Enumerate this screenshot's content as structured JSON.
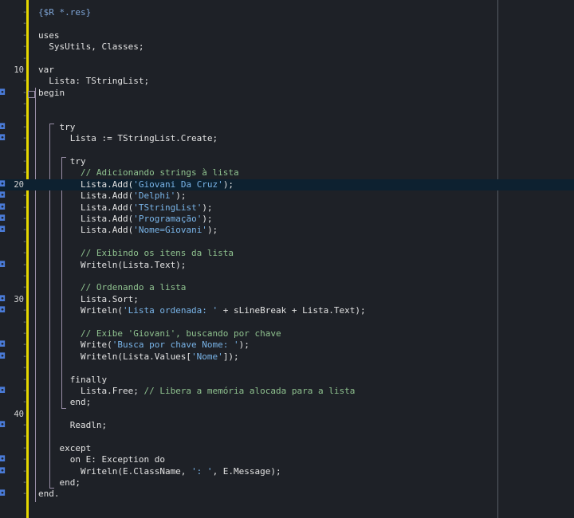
{
  "editor": {
    "lines": [
      {
        "ln": "",
        "marker": "",
        "segments": [
          {
            "t": "d",
            "v": "{$R *.res}"
          }
        ]
      },
      {
        "ln": "",
        "marker": "",
        "segments": []
      },
      {
        "ln": "",
        "marker": "",
        "segments": [
          {
            "t": "k",
            "v": "uses"
          }
        ]
      },
      {
        "ln": "",
        "marker": "",
        "segments": [
          {
            "t": "k",
            "v": "  SysUtils, Classes;"
          }
        ]
      },
      {
        "ln": "",
        "marker": "",
        "segments": []
      },
      {
        "ln": "10",
        "marker": "",
        "segments": [
          {
            "t": "k",
            "v": "var"
          }
        ]
      },
      {
        "ln": "",
        "marker": "",
        "segments": [
          {
            "t": "k",
            "v": "  Lista: TStringList;"
          }
        ]
      },
      {
        "ln": "",
        "marker": "bp",
        "segments": [
          {
            "t": "k",
            "v": "begin"
          }
        ]
      },
      {
        "ln": "",
        "marker": "",
        "segments": []
      },
      {
        "ln": "",
        "marker": "",
        "segments": []
      },
      {
        "ln": "",
        "marker": "bp",
        "segments": [
          {
            "t": "k",
            "v": "    try"
          }
        ]
      },
      {
        "ln": "",
        "marker": "bp",
        "segments": [
          {
            "t": "k",
            "v": "      Lista := TStringList.Create;"
          }
        ]
      },
      {
        "ln": "",
        "marker": "",
        "segments": []
      },
      {
        "ln": "",
        "marker": "",
        "segments": [
          {
            "t": "k",
            "v": "      try"
          }
        ]
      },
      {
        "ln": "",
        "marker": "",
        "segments": [
          {
            "t": "c",
            "v": "        // Adicionando strings à lista"
          }
        ]
      },
      {
        "ln": "20",
        "marker": "bp",
        "current": true,
        "segments": [
          {
            "t": "k",
            "v": "        Lista.Add("
          },
          {
            "t": "s",
            "v": "'Giovani Da Cruz'"
          },
          {
            "t": "k",
            "v": ");"
          }
        ]
      },
      {
        "ln": "",
        "marker": "bp",
        "segments": [
          {
            "t": "k",
            "v": "        Lista.Add("
          },
          {
            "t": "s",
            "v": "'Delphi'"
          },
          {
            "t": "k",
            "v": ");"
          }
        ]
      },
      {
        "ln": "",
        "marker": "bp",
        "segments": [
          {
            "t": "k",
            "v": "        Lista.Add("
          },
          {
            "t": "s",
            "v": "'TStringList'"
          },
          {
            "t": "k",
            "v": ");"
          }
        ]
      },
      {
        "ln": "",
        "marker": "bp",
        "segments": [
          {
            "t": "k",
            "v": "        Lista.Add("
          },
          {
            "t": "s",
            "v": "'Programação'"
          },
          {
            "t": "k",
            "v": ");"
          }
        ]
      },
      {
        "ln": "",
        "marker": "bp",
        "segments": [
          {
            "t": "k",
            "v": "        Lista.Add("
          },
          {
            "t": "s",
            "v": "'Nome=Giovani'"
          },
          {
            "t": "k",
            "v": ");"
          }
        ]
      },
      {
        "ln": "",
        "marker": "",
        "segments": []
      },
      {
        "ln": "",
        "marker": "",
        "segments": [
          {
            "t": "c",
            "v": "        // Exibindo os itens da lista"
          }
        ]
      },
      {
        "ln": "",
        "marker": "bp",
        "segments": [
          {
            "t": "k",
            "v": "        Writeln(Lista.Text);"
          }
        ]
      },
      {
        "ln": "",
        "marker": "",
        "segments": []
      },
      {
        "ln": "",
        "marker": "",
        "segments": [
          {
            "t": "c",
            "v": "        // Ordenando a lista"
          }
        ]
      },
      {
        "ln": "30",
        "marker": "bp",
        "segments": [
          {
            "t": "k",
            "v": "        Lista.Sort;"
          }
        ]
      },
      {
        "ln": "",
        "marker": "bp",
        "segments": [
          {
            "t": "k",
            "v": "        Writeln("
          },
          {
            "t": "s",
            "v": "'Lista ordenada: '"
          },
          {
            "t": "k",
            "v": " + sLineBreak + Lista.Text);"
          }
        ]
      },
      {
        "ln": "",
        "marker": "",
        "segments": []
      },
      {
        "ln": "",
        "marker": "",
        "segments": [
          {
            "t": "c",
            "v": "        // Exibe 'Giovani', buscando por chave"
          }
        ]
      },
      {
        "ln": "",
        "marker": "bp",
        "segments": [
          {
            "t": "k",
            "v": "        Write("
          },
          {
            "t": "s",
            "v": "'Busca por chave Nome: '"
          },
          {
            "t": "k",
            "v": ");"
          }
        ]
      },
      {
        "ln": "",
        "marker": "bp",
        "segments": [
          {
            "t": "k",
            "v": "        Writeln(Lista.Values["
          },
          {
            "t": "s",
            "v": "'Nome'"
          },
          {
            "t": "k",
            "v": "]);"
          }
        ]
      },
      {
        "ln": "",
        "marker": "",
        "segments": []
      },
      {
        "ln": "",
        "marker": "",
        "segments": [
          {
            "t": "k",
            "v": "      finally"
          }
        ]
      },
      {
        "ln": "",
        "marker": "bp",
        "segments": [
          {
            "t": "k",
            "v": "        Lista.Free; "
          },
          {
            "t": "c",
            "v": "// Libera a memória alocada para a lista"
          }
        ]
      },
      {
        "ln": "",
        "marker": "",
        "segments": [
          {
            "t": "k",
            "v": "      end;"
          }
        ]
      },
      {
        "ln": "40",
        "marker": "",
        "segments": []
      },
      {
        "ln": "",
        "marker": "bp",
        "segments": [
          {
            "t": "k",
            "v": "      Readln;"
          }
        ]
      },
      {
        "ln": "",
        "marker": "",
        "segments": []
      },
      {
        "ln": "",
        "marker": "",
        "segments": [
          {
            "t": "k",
            "v": "    except"
          }
        ]
      },
      {
        "ln": "",
        "marker": "bp",
        "segments": [
          {
            "t": "k",
            "v": "      on E: Exception do"
          }
        ]
      },
      {
        "ln": "",
        "marker": "bp",
        "segments": [
          {
            "t": "k",
            "v": "        Writeln(E.ClassName, "
          },
          {
            "t": "s",
            "v": "': '"
          },
          {
            "t": "k",
            "v": ", E.Message);"
          }
        ]
      },
      {
        "ln": "",
        "marker": "",
        "segments": [
          {
            "t": "k",
            "v": "    end;"
          }
        ]
      },
      {
        "ln": "",
        "marker": "bp",
        "segments": [
          {
            "t": "k",
            "v": "end."
          }
        ]
      }
    ]
  },
  "colors": {
    "background": "#1e2127",
    "change_bar": "#e6d800",
    "current_line": "#0d2130",
    "comment": "#8fc28f",
    "string": "#79b4e8",
    "directive": "#7fa6d8",
    "breakpoint_marker": "#4a7bd8"
  }
}
